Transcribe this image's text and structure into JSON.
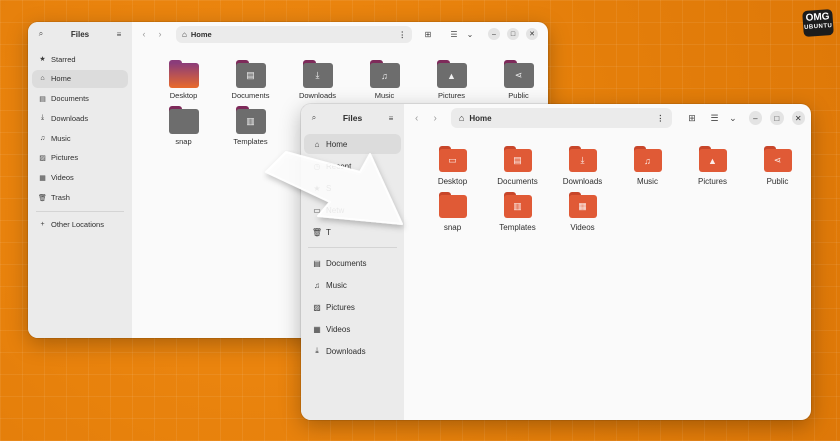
{
  "logo": {
    "line1": "OMG",
    "line2": "UBUNTU"
  },
  "colors": {
    "background": "#e8820c",
    "old_folder_tab": "#7e2a5a",
    "old_folder_body": "#6d6d6d",
    "new_folder_tab": "#c8462a",
    "new_folder_body": "#e05a36",
    "desktop_gradient_top": "#8a3c7a",
    "desktop_gradient_bottom": "#e96a2b"
  },
  "back_window": {
    "sidebar": {
      "title": "Files",
      "items": [
        {
          "icon": "star-icon",
          "glyph": "★",
          "label": "Starred"
        },
        {
          "icon": "home-icon",
          "glyph": "⌂",
          "label": "Home",
          "active": true
        },
        {
          "icon": "documents-icon",
          "glyph": "▤",
          "label": "Documents"
        },
        {
          "icon": "downloads-icon",
          "glyph": "⤓",
          "label": "Downloads"
        },
        {
          "icon": "music-icon",
          "glyph": "♫",
          "label": "Music"
        },
        {
          "icon": "pictures-icon",
          "glyph": "▨",
          "label": "Pictures"
        },
        {
          "icon": "videos-icon",
          "glyph": "▦",
          "label": "Videos"
        },
        {
          "icon": "trash-icon",
          "glyph": "🗑",
          "label": "Trash"
        }
      ],
      "other": {
        "icon": "plus-icon",
        "glyph": "+",
        "label": "Other Locations"
      }
    },
    "path": "Home",
    "folders": [
      {
        "label": "Desktop",
        "icon": "desktop-icon",
        "glyph": ""
      },
      {
        "label": "Documents",
        "icon": "documents-icon",
        "glyph": "▤"
      },
      {
        "label": "Downloads",
        "icon": "downloads-icon",
        "glyph": "⤓"
      },
      {
        "label": "Music",
        "icon": "music-icon",
        "glyph": "♫"
      },
      {
        "label": "Pictures",
        "icon": "pictures-icon",
        "glyph": "▲"
      },
      {
        "label": "Public",
        "icon": "share-icon",
        "glyph": "⋖"
      },
      {
        "label": "snap",
        "icon": "folder-icon",
        "glyph": ""
      },
      {
        "label": "Templates",
        "icon": "templates-icon",
        "glyph": "▥"
      },
      {
        "label": "Vi",
        "icon": "videos-icon",
        "glyph": "▦"
      }
    ]
  },
  "front_window": {
    "sidebar": {
      "title": "Files",
      "items": [
        {
          "icon": "home-icon",
          "glyph": "⌂",
          "label": "Home",
          "active": true
        },
        {
          "icon": "recent-icon",
          "glyph": "◷",
          "label": "Recent"
        },
        {
          "icon": "starred-icon",
          "glyph": "★",
          "label": "S"
        },
        {
          "icon": "network-icon",
          "glyph": "▭",
          "label": "Netw"
        },
        {
          "icon": "trash-icon",
          "glyph": "🗑",
          "label": "T"
        }
      ],
      "bookmarks": [
        {
          "icon": "documents-icon",
          "glyph": "▤",
          "label": "Documents"
        },
        {
          "icon": "music-icon",
          "glyph": "♫",
          "label": "Music"
        },
        {
          "icon": "pictures-icon",
          "glyph": "▨",
          "label": "Pictures"
        },
        {
          "icon": "videos-icon",
          "glyph": "▦",
          "label": "Videos"
        },
        {
          "icon": "downloads-icon",
          "glyph": "⤓",
          "label": "Downloads"
        }
      ]
    },
    "path": "Home",
    "folders": [
      {
        "label": "Desktop",
        "icon": "desktop-icon",
        "glyph": "▭"
      },
      {
        "label": "Documents",
        "icon": "documents-icon",
        "glyph": "▤"
      },
      {
        "label": "Downloads",
        "icon": "downloads-icon",
        "glyph": "⤓"
      },
      {
        "label": "Music",
        "icon": "music-icon",
        "glyph": "♫"
      },
      {
        "label": "Pictures",
        "icon": "pictures-icon",
        "glyph": "▲"
      },
      {
        "label": "Public",
        "icon": "share-icon",
        "glyph": "⋖"
      },
      {
        "label": "snap",
        "icon": "folder-icon",
        "glyph": ""
      },
      {
        "label": "Templates",
        "icon": "templates-icon",
        "glyph": "▥"
      },
      {
        "label": "Videos",
        "icon": "videos-icon",
        "glyph": "▦"
      }
    ]
  }
}
